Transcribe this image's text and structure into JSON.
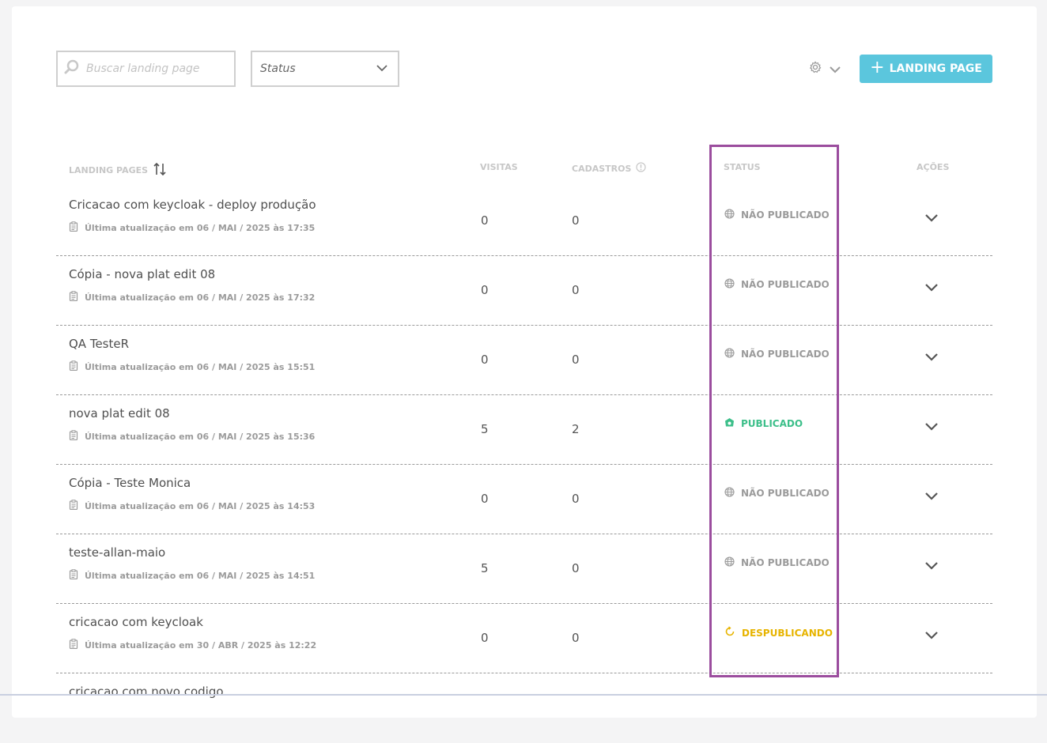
{
  "toolbar": {
    "search_placeholder": "Buscar landing page",
    "status_filter_label": "Status",
    "add_button_label": "LANDING PAGE",
    "add_button_color": "#5bc6dd"
  },
  "table": {
    "headers": {
      "landing_pages": "LANDING PAGES",
      "visits": "VISITAS",
      "registrations": "CADASTROS",
      "status": "STATUS",
      "actions": "AÇÕES"
    },
    "status_colors": {
      "nao_publicado": "#9b9b9b",
      "publicado": "#3dbf8a",
      "despublicando": "#e7b400"
    },
    "rows": [
      {
        "name": "Cricacao com keycloak - deploy produção",
        "updated": "Última atualização em 06 / MAI / 2025 às 17:35",
        "visits": "0",
        "registrations": "0",
        "status": "NÃO PUBLICADO",
        "status_type": "nao_publicado"
      },
      {
        "name": "Cópia - nova plat edit 08",
        "updated": "Última atualização em 06 / MAI / 2025 às 17:32",
        "visits": "0",
        "registrations": "0",
        "status": "NÃO PUBLICADO",
        "status_type": "nao_publicado"
      },
      {
        "name": "QA TesteR",
        "updated": "Última atualização em 06 / MAI / 2025 às 15:51",
        "visits": "0",
        "registrations": "0",
        "status": "NÃO PUBLICADO",
        "status_type": "nao_publicado"
      },
      {
        "name": "nova plat edit 08",
        "updated": "Última atualização em 06 / MAI / 2025 às 15:36",
        "visits": "5",
        "registrations": "2",
        "status": "PUBLICADO",
        "status_type": "publicado"
      },
      {
        "name": "Cópia - Teste Monica",
        "updated": "Última atualização em 06 / MAI / 2025 às 14:53",
        "visits": "0",
        "registrations": "0",
        "status": "NÃO PUBLICADO",
        "status_type": "nao_publicado"
      },
      {
        "name": "teste-allan-maio",
        "updated": "Última atualização em 06 / MAI / 2025 às 14:51",
        "visits": "5",
        "registrations": "0",
        "status": "NÃO PUBLICADO",
        "status_type": "nao_publicado"
      },
      {
        "name": "cricacao com keycloak",
        "updated": "Última atualização em 30 / ABR / 2025 às 12:22",
        "visits": "0",
        "registrations": "0",
        "status": "DESPUBLICANDO",
        "status_type": "despublicando"
      },
      {
        "name": "cricacao com novo codigo",
        "updated": "",
        "visits": "",
        "registrations": "",
        "status": "",
        "status_type": ""
      }
    ]
  },
  "highlight_color": "#9b4d9e"
}
